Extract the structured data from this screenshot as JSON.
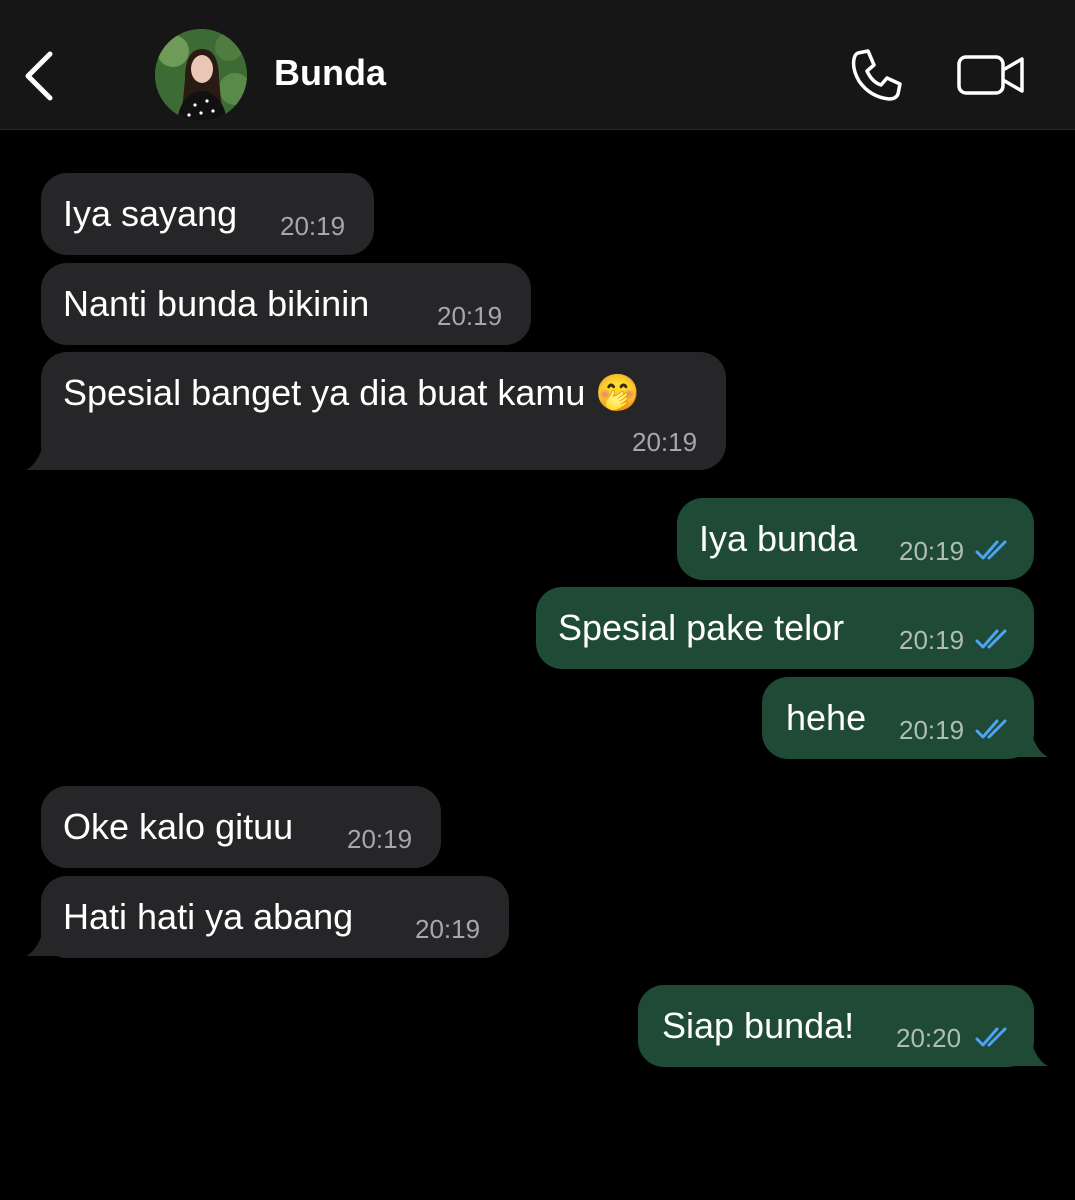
{
  "header": {
    "contact_name": "Bunda",
    "avatar": "contact-avatar-photo",
    "icons": [
      "back-chevron-icon",
      "phone-icon",
      "video-camera-icon"
    ]
  },
  "colors": {
    "background": "#000000",
    "header_bg": "#161616",
    "incoming_bubble": "#262628",
    "outgoing_bubble": "#1f4a36",
    "read_receipt": "#4ea3f5"
  },
  "messages": [
    {
      "direction": "incoming",
      "text": "Iya sayang",
      "time": "20:19"
    },
    {
      "direction": "incoming",
      "text": "Nanti bunda bikinin",
      "time": "20:19"
    },
    {
      "direction": "incoming",
      "text": "Spesial banget ya dia buat kamu 🤭",
      "time": "20:19"
    },
    {
      "direction": "outgoing",
      "text": "Iya bunda",
      "time": "20:19",
      "status": "read"
    },
    {
      "direction": "outgoing",
      "text": "Spesial pake telor",
      "time": "20:19",
      "status": "read"
    },
    {
      "direction": "outgoing",
      "text": "hehe",
      "time": "20:19",
      "status": "read"
    },
    {
      "direction": "incoming",
      "text": "Oke kalo gituu",
      "time": "20:19"
    },
    {
      "direction": "incoming",
      "text": "Hati hati ya abang",
      "time": "20:19"
    },
    {
      "direction": "outgoing",
      "text": "Siap bunda!",
      "time": "20:20",
      "status": "read"
    }
  ]
}
